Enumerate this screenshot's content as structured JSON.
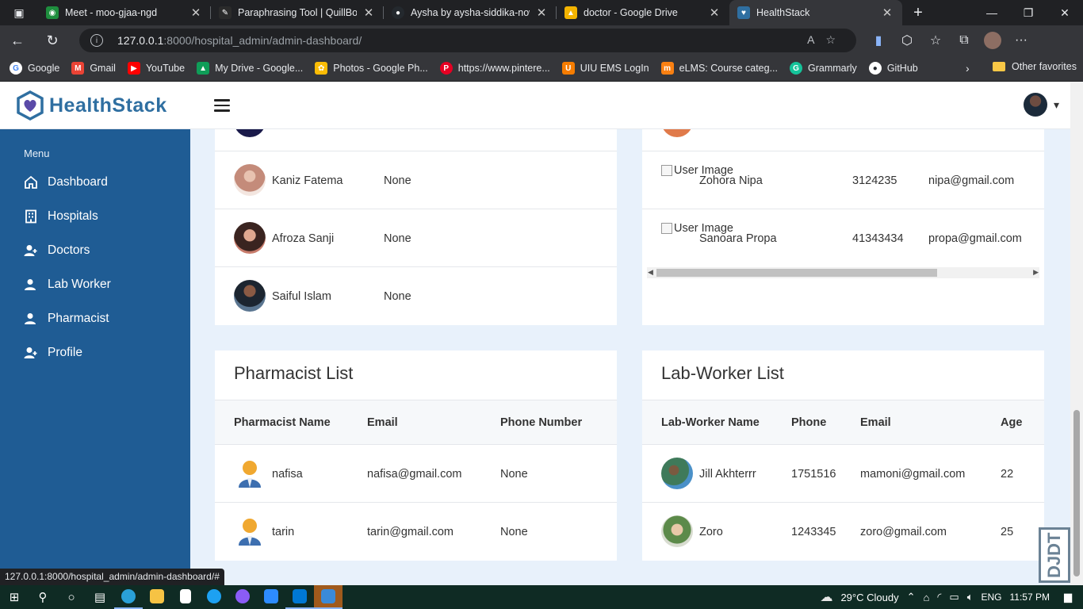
{
  "browser": {
    "tabs": [
      {
        "title": "Meet - moo-gjaa-ngd",
        "icon": "meet-icon",
        "color": "#1e8e3e"
      },
      {
        "title": "Paraphrasing Tool | QuillBot AI",
        "icon": "quillbot-icon",
        "color": "#2b2b2b"
      },
      {
        "title": "Aysha by aysha-siddika-nows",
        "icon": "github-icon",
        "color": "#24292e"
      },
      {
        "title": "doctor - Google Drive",
        "icon": "drive-icon",
        "color": "#f4b400"
      },
      {
        "title": "HealthStack",
        "icon": "healthstack-icon",
        "color": "#2f6fa1",
        "active": true
      }
    ],
    "url_host": "127.0.0.1",
    "url_path": ":8000/hospital_admin/admin-dashboard/",
    "bookmarks": [
      {
        "label": "Google",
        "color": "#4285f4",
        "glyph": "G"
      },
      {
        "label": "Gmail",
        "color": "#ea4335",
        "glyph": "M"
      },
      {
        "label": "YouTube",
        "color": "#ff0000",
        "glyph": "▶"
      },
      {
        "label": "My Drive - Google...",
        "color": "#0f9d58",
        "glyph": "▲"
      },
      {
        "label": "Photos - Google Ph...",
        "color": "#fbbc05",
        "glyph": "✿"
      },
      {
        "label": "https://www.pintere...",
        "color": "#e60023",
        "glyph": "P"
      },
      {
        "label": "UIU EMS LogIn",
        "color": "#f57c00",
        "glyph": "U"
      },
      {
        "label": "eLMS: Course categ...",
        "color": "#f98012",
        "glyph": "m"
      },
      {
        "label": "Grammarly",
        "color": "#15c39a",
        "glyph": "G"
      },
      {
        "label": "GitHub",
        "color": "#24292e",
        "glyph": "●"
      }
    ],
    "bookmarks_other": "Other favorites",
    "status_url": "127.0.0.1:8000/hospital_admin/admin-dashboard/#"
  },
  "app": {
    "brand": "HealthStack",
    "menu_title": "Menu",
    "sidebar": [
      {
        "label": "Dashboard",
        "icon": "home-icon"
      },
      {
        "label": "Hospitals",
        "icon": "building-icon"
      },
      {
        "label": "Doctors",
        "icon": "user-plus-icon"
      },
      {
        "label": "Lab Worker",
        "icon": "user-icon"
      },
      {
        "label": "Pharmacist",
        "icon": "user-icon"
      },
      {
        "label": "Profile",
        "icon": "user-plus-icon"
      }
    ]
  },
  "doctor_list": {
    "rows": [
      {
        "name": "Kaniz Fatema",
        "value": "None",
        "avatar": "#c48b7a"
      },
      {
        "name": "Afroza Sanji",
        "value": "None",
        "avatar": "#7a4b3c"
      },
      {
        "name": "Saiful Islam",
        "value": "None",
        "avatar": "#2b3a4a"
      }
    ]
  },
  "patient_list": {
    "rows": [
      {
        "img_alt": "User Image",
        "name": "Zohora Nipa",
        "phone": "3124235",
        "email": "nipa@gmail.com"
      },
      {
        "img_alt": "User Image",
        "name": "Sanoara Propa",
        "phone": "41343434",
        "email": "propa@gmail.com"
      }
    ]
  },
  "pharmacist_list": {
    "title": "Pharmacist List",
    "columns": [
      "Pharmacist Name",
      "Email",
      "Phone Number"
    ],
    "rows": [
      {
        "name": "nafisa",
        "email": "nafisa@gmail.com",
        "phone": "None"
      },
      {
        "name": "tarin",
        "email": "tarin@gmail.com",
        "phone": "None"
      }
    ]
  },
  "labworker_list": {
    "title": "Lab-Worker List",
    "columns": [
      "Lab-Worker Name",
      "Phone",
      "Email",
      "Age"
    ],
    "rows": [
      {
        "name": "Jill Akhterrr",
        "phone": "1751516",
        "email": "mamoni@gmail.com",
        "age": "22",
        "avatar": "#3f7a5a"
      },
      {
        "name": "Zoro",
        "phone": "1243345",
        "email": "zoro@gmail.com",
        "age": "25",
        "avatar": "#5c8a4a"
      }
    ]
  },
  "watermark": "DJDT",
  "taskbar": {
    "weather": "29°C  Cloudy",
    "lang": "ENG",
    "time": "11:57 PM"
  }
}
